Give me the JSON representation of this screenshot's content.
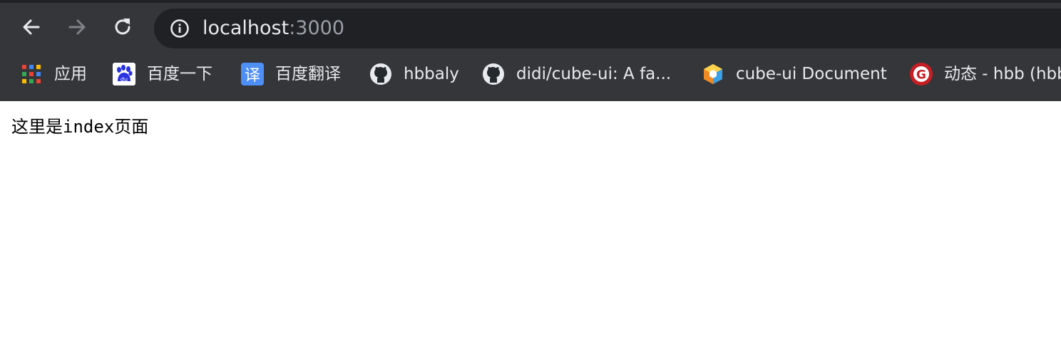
{
  "browser": {
    "address_bar": {
      "host": "localhost",
      "port": ":3000",
      "info_icon": "info-icon"
    },
    "nav": {
      "back_icon": "arrow-left-icon",
      "forward_icon": "arrow-right-icon",
      "reload_icon": "reload-icon"
    },
    "bookmarks": [
      {
        "label": "应用",
        "icon": "apps-grid-icon"
      },
      {
        "label": "百度一下",
        "icon": "baidu-icon"
      },
      {
        "label": "百度翻译",
        "icon": "baidu-translate-icon",
        "icon_text": "译"
      },
      {
        "label": "hbbaly",
        "icon": "github-icon"
      },
      {
        "label": "didi/cube-ui: A fa...",
        "icon": "github-icon"
      },
      {
        "label": "cube-ui Document",
        "icon": "cube-ui-icon"
      },
      {
        "label": "动态 - hbb (hbb",
        "icon": "gitee-icon",
        "icon_text": "G"
      }
    ]
  },
  "page": {
    "text_before": "这里是",
    "text_code": "index",
    "text_after": "页面"
  },
  "colors": {
    "chrome_bg": "#35363a",
    "omnibox_bg": "#202124",
    "text_primary": "#e8eaed",
    "text_muted": "#9aa0a6"
  }
}
